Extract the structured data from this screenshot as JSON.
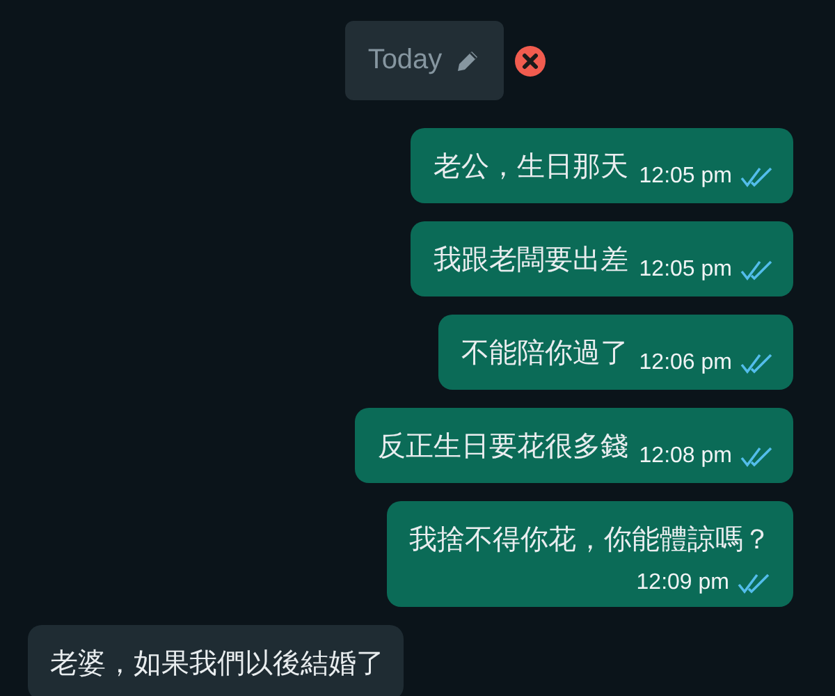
{
  "date_chip": {
    "label": "Today"
  },
  "messages": [
    {
      "kind": "outgoing",
      "text": "老公，生日那天",
      "time": "12:05 pm",
      "read": true
    },
    {
      "kind": "outgoing",
      "text": "我跟老闆要出差",
      "time": "12:05 pm",
      "read": true
    },
    {
      "kind": "outgoing",
      "text": "不能陪你過了",
      "time": "12:06 pm",
      "read": true
    },
    {
      "kind": "outgoing",
      "text": "反正生日要花很多錢",
      "time": "12:08 pm",
      "read": true
    },
    {
      "kind": "outgoing",
      "text": "我捨不得你花，你能體諒嗎？",
      "time": "12:09 pm",
      "read": true,
      "multiline": true
    },
    {
      "kind": "incoming",
      "text": "老婆，如果我們以後結婚了"
    }
  ]
}
